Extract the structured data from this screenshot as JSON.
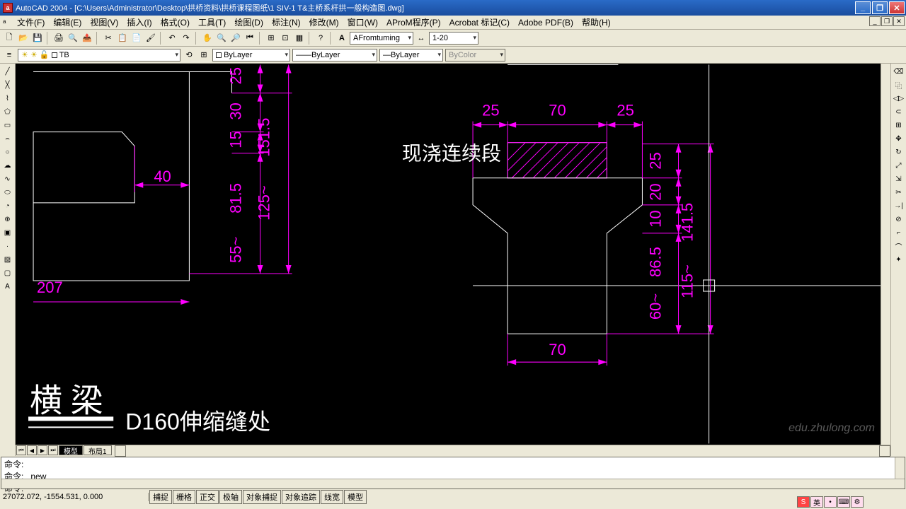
{
  "title": "AutoCAD 2004 - [C:\\Users\\Administrator\\Desktop\\拱桥资料\\拱桥课程图纸\\1    SIV-1    T&主桥系杆拱一般构造图.dwg]",
  "menus": [
    "文件(F)",
    "编辑(E)",
    "视图(V)",
    "插入(I)",
    "格式(O)",
    "工具(T)",
    "绘图(D)",
    "标注(N)",
    "修改(M)",
    "窗口(W)",
    "AProM程序(P)",
    "Acrobat 标记(C)",
    "Adobe PDF(B)",
    "帮助(H)"
  ],
  "toolbar1": {
    "textstyle": "AFromtuming",
    "dimscale": "1-20"
  },
  "props": {
    "layer": "TB",
    "layer_current": "ByLayer",
    "linetype": "ByLayer",
    "lineweight": "ByLayer",
    "plotstyle": "ByColor"
  },
  "tabs": [
    "模型",
    "布局1"
  ],
  "cmd": {
    "prompt1": "命令:",
    "prompt2": "命令: _new",
    "prompt3": "命令:"
  },
  "coords": "27072.072, -1554.531, 0.000",
  "status_btns": [
    "捕捉",
    "栅格",
    "正交",
    "极轴",
    "对象捕捉",
    "对象追踪",
    "线宽",
    "模型"
  ],
  "drawing": {
    "label_xianhao": "现浇连续段",
    "label_hengliang": "横 梁",
    "label_d160": "D160伸缩缝处",
    "dims": {
      "d40": "40",
      "d207": "207",
      "d25a": "25",
      "d30": "30",
      "d15": "15",
      "d151": "151.5",
      "d125": "125~",
      "d81": "81.5",
      "d55": "55~",
      "d25L": "25",
      "d70T": "70",
      "d25R": "25",
      "d70B": "70",
      "d25v": "25",
      "d20": "20",
      "d10": "10",
      "d86": "86.5",
      "d60": "60~",
      "d141": "141.5",
      "d115": "115~"
    }
  },
  "watermark": "edu.zhulong.com"
}
